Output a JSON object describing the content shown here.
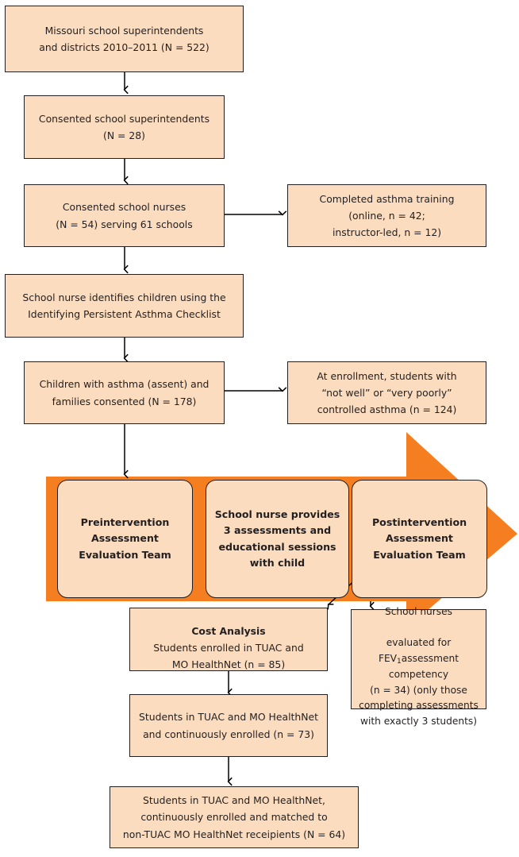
{
  "colors": {
    "box_fill": "#FBDCBE",
    "box_border": "#231f20",
    "band_orange": "#F57E20",
    "arrow_line": "#000000",
    "page_background": "#FFFFFF",
    "text": "#231f20"
  },
  "diagram": {
    "type": "flowchart",
    "orientation": "top-to-bottom",
    "title_text": ""
  },
  "nodes": {
    "superintendents_districts": {
      "text": "Missouri school superintendents\nand districts 2010–2011 (N = 522)"
    },
    "consented_superintendents": {
      "text": "Consented school superintendents\n(N = 28)"
    },
    "consented_nurses": {
      "text": "Consented school nurses\n(N = 54) serving 61 schools"
    },
    "asthma_training": {
      "text": "Completed asthma training\n(online, n = 42;\ninstructor-led, n = 12)"
    },
    "checklist": {
      "text": "School nurse identifies children using the\nIdentifying Persistent Asthma Checklist"
    },
    "children_consented": {
      "text": "Children with asthma (assent) and\nfamilies consented (N = 178)"
    },
    "uncontrolled_asthma": {
      "text": "At enrollment, students with\n“not well” or “very poorly”\ncontrolled asthma (n = 124)"
    },
    "preintervention": {
      "text": "Preintervention\nAssessment\nEvaluation Team"
    },
    "nurse_sessions": {
      "text": "School nurse provides\n3 assessments and\neducational sessions\nwith child"
    },
    "postintervention": {
      "text": "Postintervention\nAssessment\nEvaluation Team"
    },
    "cost_analysis": {
      "heading": "Cost Analysis",
      "text": "Students enrolled in TUAC and\nMO HealthNet (n = 85)"
    },
    "nurse_competency": {
      "line1": "School nurses",
      "line2_pre": "evaluated for FEV",
      "line2_sub": "1",
      "rest": "assessment competency\n(n = 34) (only those\ncompleting assessments\nwith exactly 3 students)"
    },
    "continuously_enrolled": {
      "text": "Students in TUAC and MO HealthNet\nand continuously enrolled (n = 73)"
    },
    "matched_cohort": {
      "text": "Students in TUAC and MO HealthNet,\ncontinuously enrolled and matched to\nnon-TUAC MO HealthNet receipients (N = 64)"
    }
  }
}
